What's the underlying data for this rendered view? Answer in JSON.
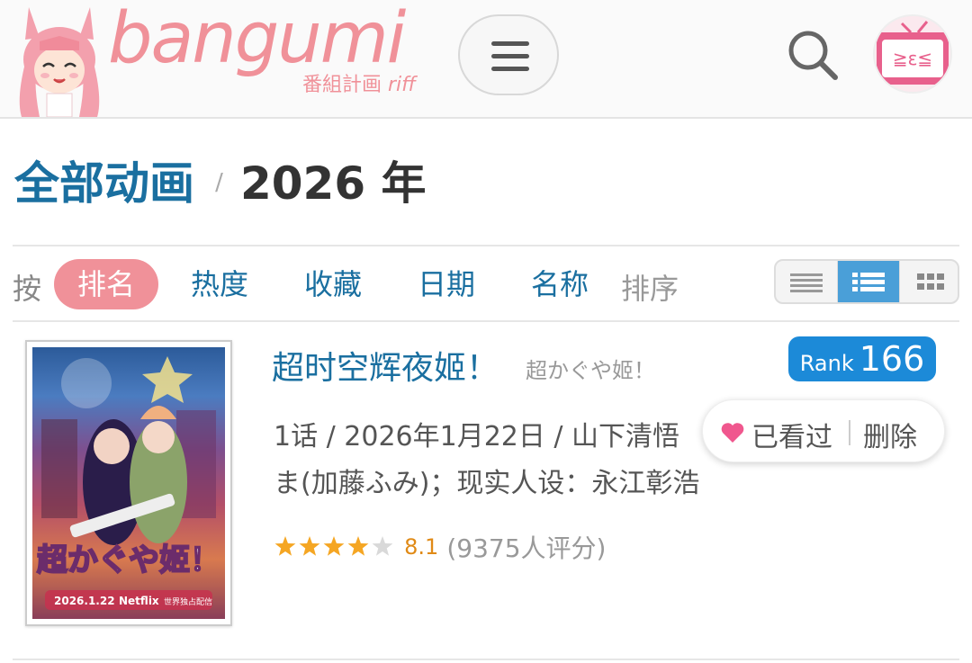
{
  "header": {
    "logo_text": "bangumi",
    "logo_sub_cn": "番組計画",
    "logo_sub_riff": "riff",
    "menu_label": "menu",
    "search_label": "search",
    "avatar_face": "≧ε≦"
  },
  "breadcrumb": {
    "parent": "全部动画",
    "separator": "/",
    "current": "2026 年"
  },
  "sortbar": {
    "prefix": "按",
    "items": [
      {
        "label": "排名",
        "active": true
      },
      {
        "label": "热度",
        "active": false
      },
      {
        "label": "收藏",
        "active": false
      },
      {
        "label": "日期",
        "active": false
      },
      {
        "label": "名称",
        "active": false
      }
    ],
    "suffix": "排序",
    "view_modes": [
      "list-compact",
      "list-detail",
      "grid"
    ],
    "active_view": "list-detail"
  },
  "items": [
    {
      "title": "超时空辉夜姬！",
      "original_title": "超かぐや姬！",
      "rank_label": "Rank",
      "rank": "166",
      "info_line1": "1话 / 2026年1月22日 / 山下清悟",
      "info_line2": "ま(加藤ふみ)；现实人设：永江彰浩",
      "stars": 4,
      "stars_max": 5,
      "score": "8.1",
      "votes": "(9375人评分)",
      "collect_status": "已看过",
      "delete_label": "删除",
      "cover_caption": "超かぐや姬！",
      "cover_release": "2026.1.22",
      "cover_platform": "Netflix",
      "cover_note": "世界独占配信"
    }
  ],
  "colors": {
    "brand_pink": "#f09199",
    "link_blue": "#1a6fa0",
    "rank_blue": "#1c8ad8",
    "star_gold": "#f5a623",
    "score_orange": "#e08a16"
  }
}
